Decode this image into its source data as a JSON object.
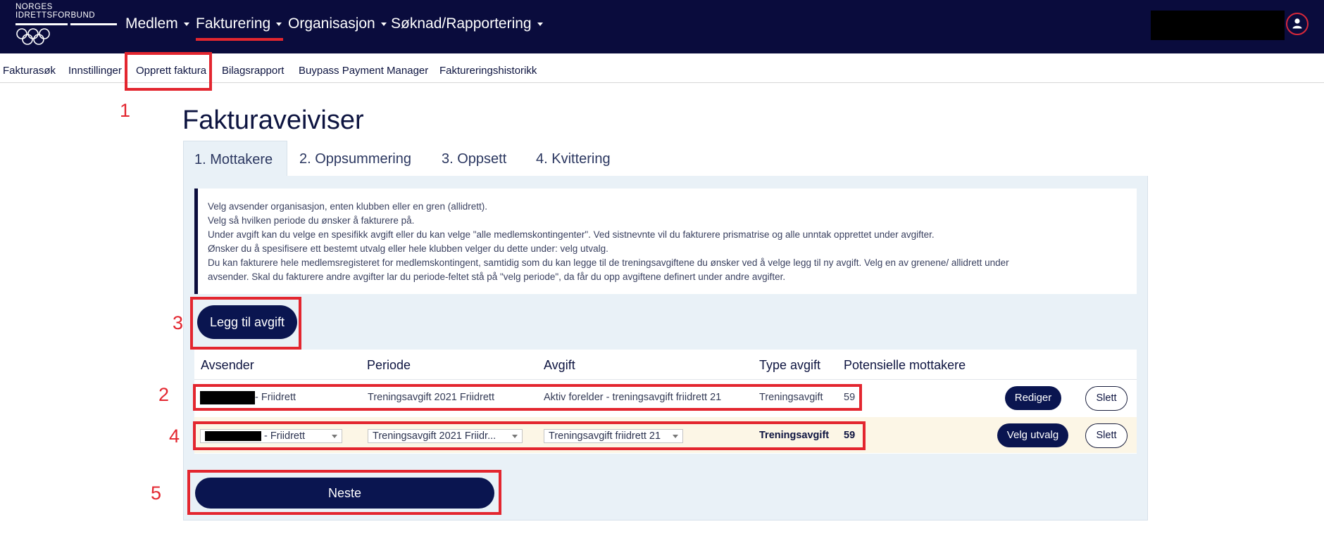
{
  "brand": {
    "line1": "NORGES",
    "line2": "IDRETTSFORBUND"
  },
  "main_nav": [
    {
      "label": "Medlem"
    },
    {
      "label": "Fakturering"
    },
    {
      "label": "Organisasjon"
    },
    {
      "label": "Søknad/Rapportering"
    }
  ],
  "sub_nav": [
    "Fakturasøk",
    "Innstillinger",
    "Opprett faktura",
    "Bilagsrapport",
    "Buypass Payment Manager",
    "Faktureringshistorikk"
  ],
  "annotations": [
    "1",
    "2",
    "3",
    "4",
    "5"
  ],
  "page_title": "Fakturaveiviser",
  "tabs": [
    "1. Mottakere",
    "2. Oppsummering",
    "3. Oppsett",
    "4. Kvittering"
  ],
  "info_lines": [
    "Velg avsender organisasjon, enten klubben eller en gren (allidrett).",
    "Velg så hvilken periode du ønsker å fakturere på.",
    "Under avgift kan du velge en spesifikk avgift eller du kan velge \"alle medlemskontingenter\". Ved sistnevnte vil du fakturere prismatrise og alle unntak opprettet under avgifter.",
    "Ønsker du å spesifisere ett bestemt utvalg eller hele klubben velger du dette under: velg utvalg.",
    "Du kan fakturere hele medlemsregisteret for medlemskontingent, samtidig som du kan legge til de treningsavgiftene du ønsker ved å velge legg til ny avgift. Velg en av grenene/ allidrett under",
    "avsender. Skal du fakturere andre avgifter lar du periode-feltet stå på \"velg periode\", da får du opp avgiftene definert under andre avgifter."
  ],
  "add_fee_button": "Legg til avgift",
  "table": {
    "headers": [
      "Avsender",
      "Periode",
      "Avgift",
      "Type avgift",
      "Potensielle mottakere"
    ],
    "row1": {
      "sender": "- Friidrett",
      "period": "Treningsavgift 2021 Friidrett",
      "fee": "Aktiv forelder - treningsavgift friidrett 21",
      "type": "Treningsavgift",
      "recipients": "59",
      "edit_button": "Rediger",
      "delete_button": "Slett"
    },
    "row2": {
      "sender_select": "- Friidrett",
      "period_select": "Treningsavgift 2021 Friidr...",
      "fee_select": "Treningsavgift friidrett 21",
      "type": "Treningsavgift",
      "recipients": "59",
      "select_button": "Velg utvalg",
      "delete_button": "Slett"
    }
  },
  "next_button": "Neste",
  "colors": {
    "navy": "#0a0c3d",
    "button": "#0a1550",
    "annotation_red": "#e3262f",
    "panel": "#e9f1f7",
    "row_highlight": "#fcf6e6"
  }
}
